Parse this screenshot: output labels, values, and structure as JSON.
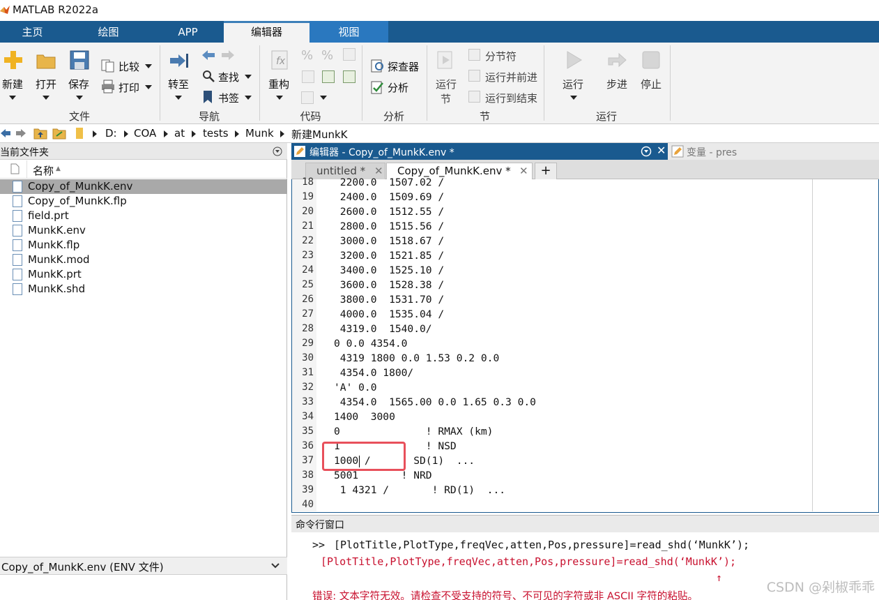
{
  "window": {
    "title": "MATLAB R2022a"
  },
  "tabs": [
    "主页",
    "绘图",
    "APP",
    "编辑器",
    "视图"
  ],
  "ribbon": {
    "file": {
      "new": "新建",
      "open": "打开",
      "save": "保存",
      "compare": "比较",
      "print": "打印",
      "label": "文件"
    },
    "nav": {
      "goto": "转至",
      "find": "查找",
      "bookmark": "书签",
      "label": "导航"
    },
    "code": {
      "refactor": "重构",
      "label": "代码"
    },
    "analyze": {
      "explorer": "探查器",
      "analyze": "分析",
      "label": "分析"
    },
    "section": {
      "run_section_1": "运行",
      "run_section_2": "节",
      "break": "分节符",
      "run_advance": "运行并前进",
      "run_to_end": "运行到结束",
      "label": "节"
    },
    "run": {
      "run": "运行",
      "step": "步进",
      "stop": "停止",
      "label": "运行"
    }
  },
  "address": {
    "path": [
      "D:",
      "COA",
      "at",
      "tests",
      "Munk",
      "新建MunkK"
    ]
  },
  "current_folder": {
    "title": "当前文件夹",
    "column_name": "名称",
    "files": [
      "Copy_of_MunkK.env",
      "Copy_of_MunkK.flp",
      "field.prt",
      "MunkK.env",
      "MunkK.flp",
      "MunkK.mod",
      "MunkK.prt",
      "MunkK.shd"
    ],
    "selected_index": 0,
    "detail": "Copy_of_MunkK.env  (ENV 文件)"
  },
  "editor": {
    "title": "编辑器 - Copy_of_MunkK.env *",
    "variables_title": "变量 - pres",
    "tabs": [
      "untitled *",
      "Copy_of_MunkK.env *"
    ],
    "active_tab": 1,
    "line_numbers": [
      "18",
      "19",
      "20",
      "21",
      "22",
      "23",
      "24",
      "25",
      "26",
      "27",
      "28",
      "29",
      "30",
      "31",
      "32",
      "33",
      "34",
      "35",
      "36",
      "37",
      "38",
      "39",
      "40"
    ],
    "lines": [
      " 2200.0  1507.02 /",
      " 2400.0  1509.69 /",
      " 2600.0  1512.55 /",
      " 2800.0  1515.56 /",
      " 3000.0  1518.67 /",
      " 3200.0  1521.85 /",
      " 3400.0  1525.10 /",
      " 3600.0  1528.38 /",
      " 3800.0  1531.70 /",
      " 4000.0  1535.04 /",
      " 4319.0  1540.0/",
      "0 0.0 4354.0",
      " 4319 1800 0.0 1.53 0.2 0.0",
      " 4354.0 1800/",
      "'A' 0.0",
      " 4354.0  1565.00 0.0 1.65 0.3 0.0",
      "1400  3000",
      "0              ! RMAX (km)",
      "1              ! NSD",
      "1000 /     ! SD(1)  ...",
      "5001       ! NRD",
      " 1 4321 /       ! RD(1)  ...",
      ""
    ]
  },
  "command_window": {
    "title": "命令行窗口",
    "prompt": ">>",
    "input": "[PlotTitle,PlotType,freqVec,atten,Pos,pressure]=read_shd(‘MunkK’);",
    "echo": "[PlotTitle,PlotType,freqVec,atten,Pos,pressure]=read_shd(‘MunkK’);",
    "caret": "↑",
    "error": "错误: 文本字符无效。请检查不受支持的符号、不可见的字符或非 ASCII 字符的粘贴。"
  },
  "watermark": "CSDN @剁椒乖乖",
  "colors": {
    "tab_bar": "#1a5a8f",
    "ribbon": "#f3f3f3",
    "error": "#c8102e",
    "highlight": "#e8505b"
  }
}
